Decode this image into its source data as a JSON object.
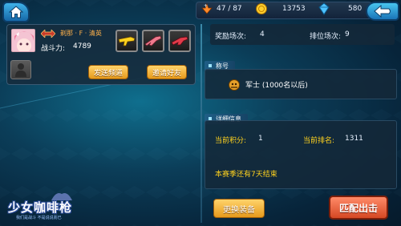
{
  "topbar": {
    "stamina": "47 / 87",
    "gold": "13753",
    "gems": "580"
  },
  "player": {
    "name": "剃那 · F · 清英",
    "power_label": "战斗力:",
    "power_value": "4789"
  },
  "buttons": {
    "send_channel": "发送频道",
    "invite_friend": "邀请好友",
    "change_gear": "更换装备",
    "match_start": "匹配出击"
  },
  "stats": {
    "reward_label": "奖励场次:",
    "reward_value": "4",
    "rank_label": "排位场次:",
    "rank_value": "9"
  },
  "title_section": {
    "header": "称号",
    "title_text": "军士 (1000名以后)"
  },
  "detail": {
    "header": "详细信息",
    "points_label": "当前积分:",
    "points_value": "1",
    "rank_label": "当前排名:",
    "rank_value": "1311",
    "season_text": "本赛季还有7天结束"
  },
  "logo": {
    "title": "少女咖啡枪",
    "subtitle": "我们是战斗 不是说说而已"
  },
  "colors": {
    "accent_yellow": "#ffd21e",
    "orange_button": "#e69a1c",
    "red_button": "#d54824",
    "blue_button": "#1a74b7"
  }
}
